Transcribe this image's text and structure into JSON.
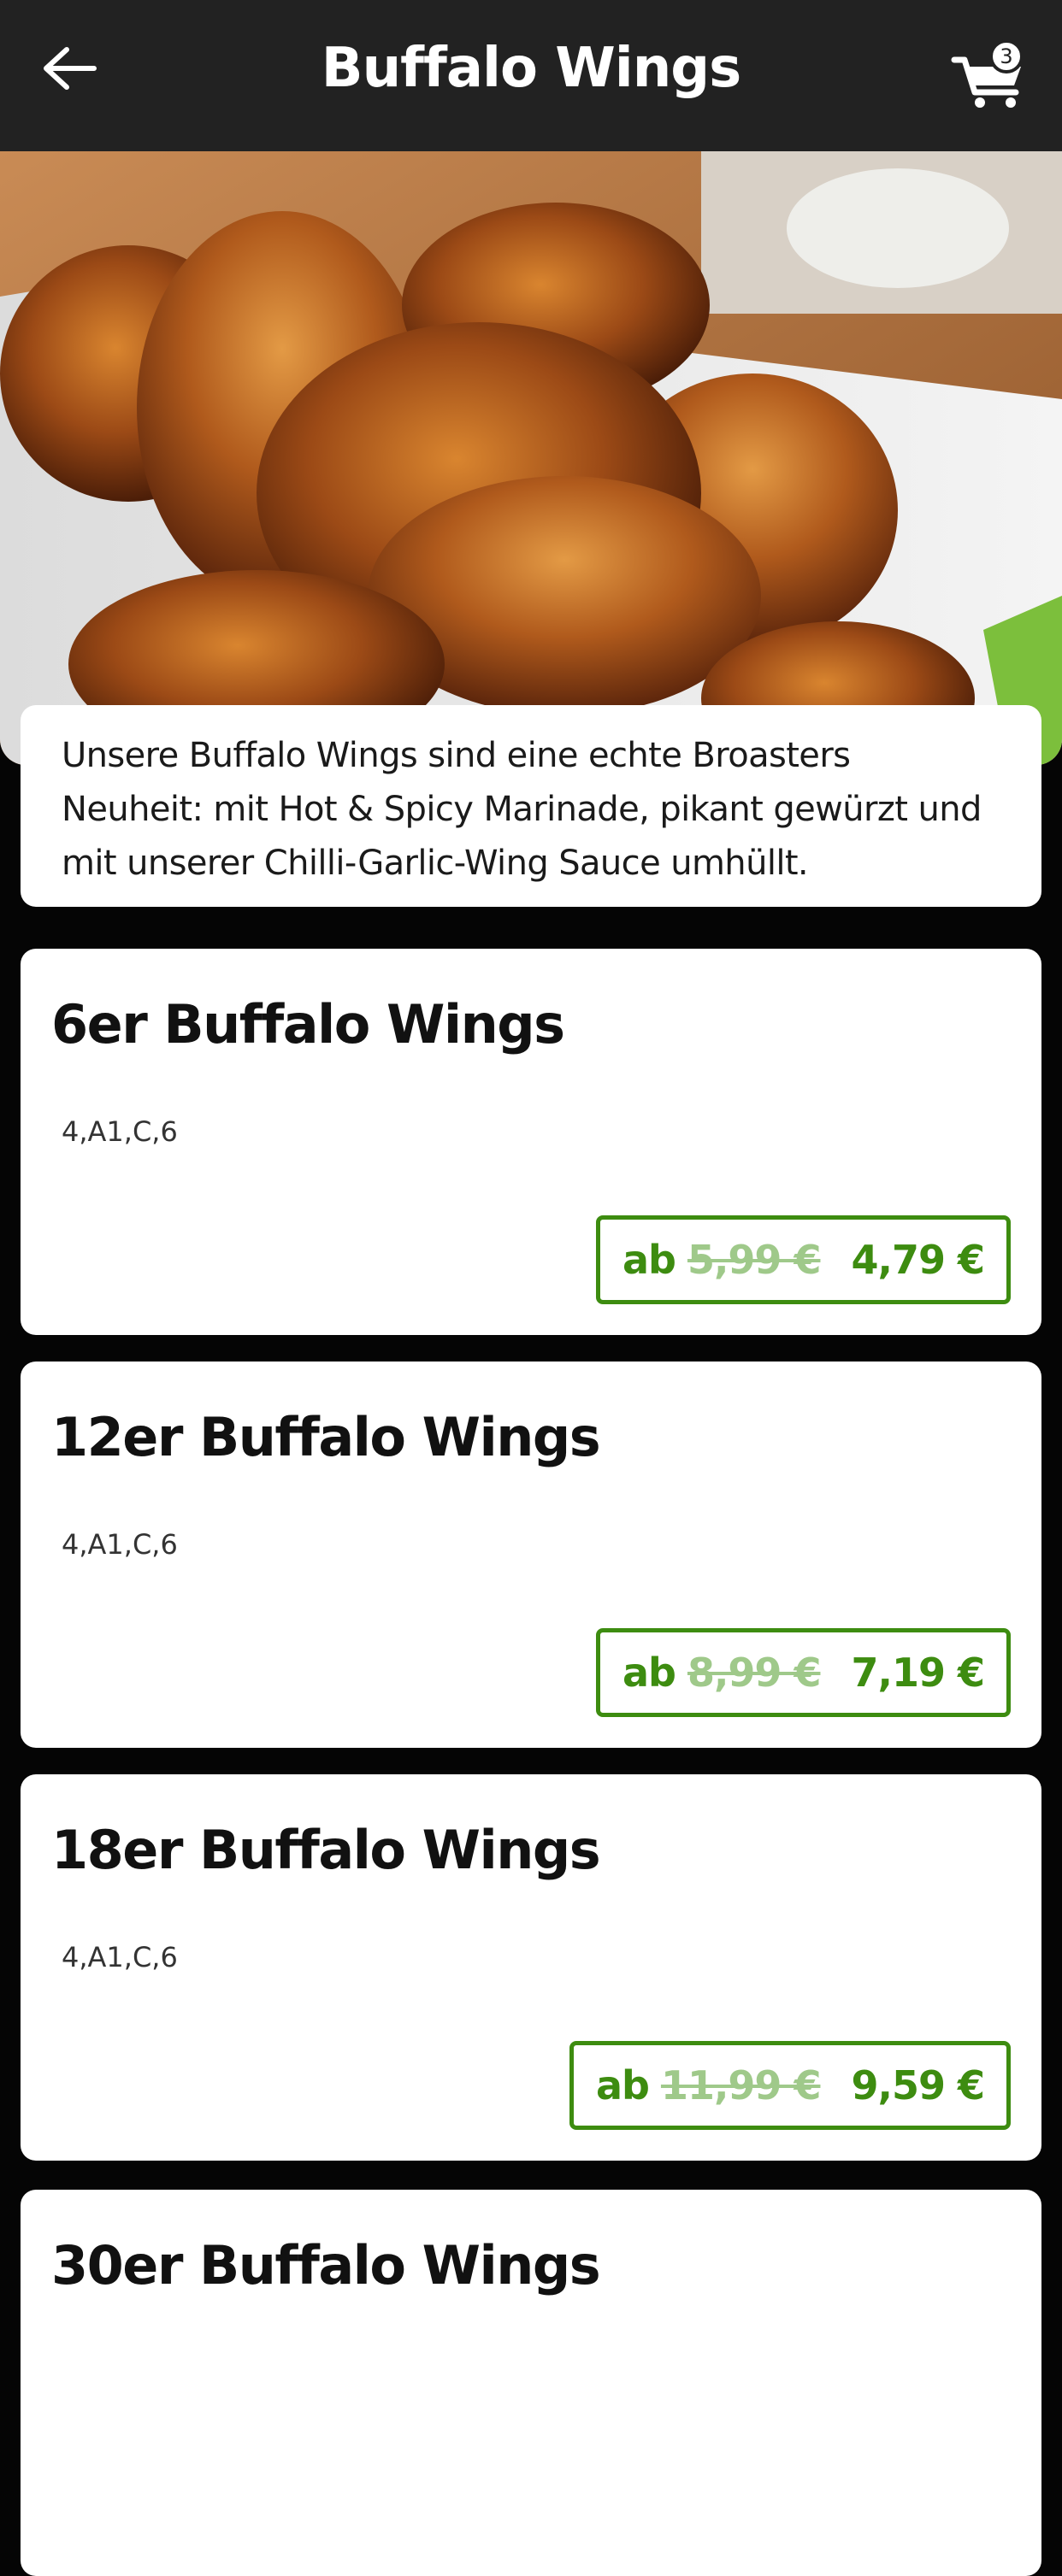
{
  "header": {
    "title": "Buffalo Wings",
    "cart_count": "3",
    "back_icon": "arrow-left-icon",
    "cart_icon": "shopping-cart-icon"
  },
  "category": {
    "description": "Unsere Buffalo Wings sind eine echte Broasters Neuheit: mit Hot & Spicy Marinade, pikant gewürzt und mit unserer Chilli-Garlic-Wing Sauce umhüllt."
  },
  "products": [
    {
      "name": "6er Buffalo Wings",
      "allergens": "4,A1,C,6",
      "price_prefix": "ab",
      "old_price": "5,99 €",
      "price": "4,79 €"
    },
    {
      "name": "12er Buffalo Wings",
      "allergens": "4,A1,C,6",
      "price_prefix": "ab",
      "old_price": "8,99 €",
      "price": "7,19 €"
    },
    {
      "name": "18er Buffalo Wings",
      "allergens": "4,A1,C,6",
      "price_prefix": "ab",
      "old_price": "11,99 €",
      "price": "9,59 €"
    },
    {
      "name": "30er Buffalo Wings"
    }
  ],
  "colors": {
    "header_bg": "#222222",
    "page_bg": "#050505",
    "price_green": "#3d8c10",
    "old_price_green": "#9fc98a"
  }
}
